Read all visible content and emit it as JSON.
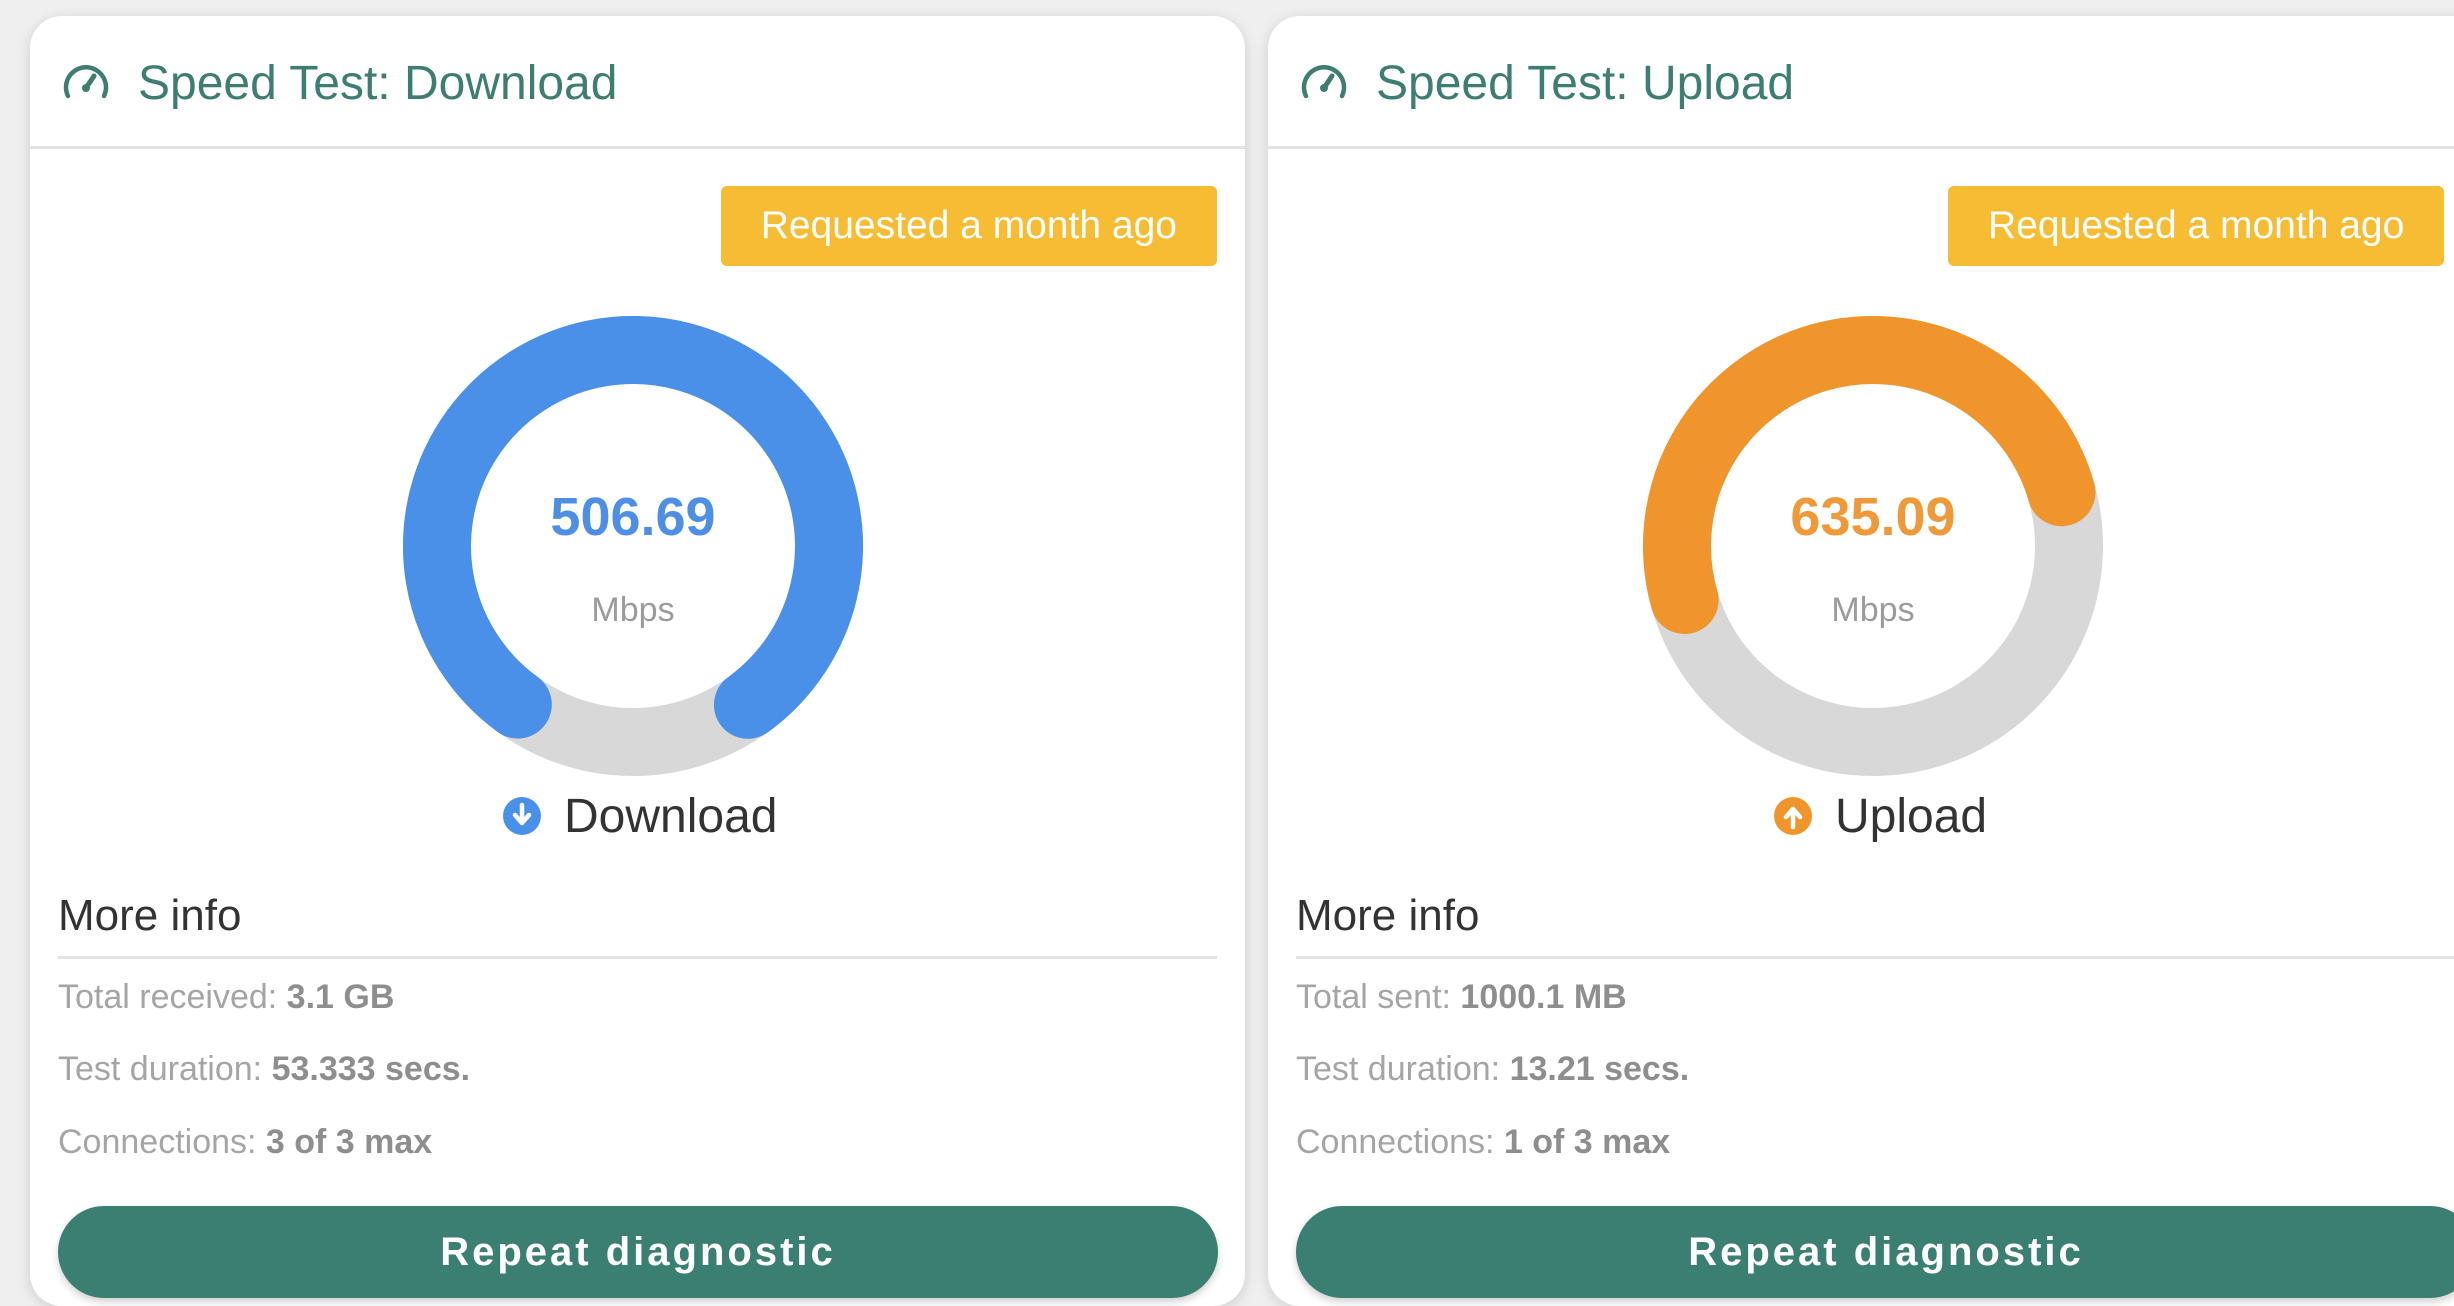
{
  "cards": [
    {
      "title": "Speed Test: Download",
      "badge": "Requested a month ago",
      "value": "506.69",
      "unit": "Mbps",
      "legend": "Download",
      "gauge_level": 0.8,
      "more_info": "More info",
      "rows": [
        {
          "label": "Total received: ",
          "value": "3.1 GB"
        },
        {
          "label": "Test duration: ",
          "value": "53.333 secs."
        },
        {
          "label": "Connections: ",
          "value": "3 of 3 max"
        }
      ],
      "button": "Repeat diagnostic"
    },
    {
      "title": "Speed Test: Upload",
      "badge": "Requested a month ago",
      "value": "635.09",
      "unit": "Mbps",
      "legend": "Upload",
      "gauge_level": 0.5,
      "more_info": "More info",
      "rows": [
        {
          "label": "Total sent: ",
          "value": "1000.1 MB"
        },
        {
          "label": "Test duration: ",
          "value": "13.21 secs."
        },
        {
          "label": "Connections: ",
          "value": "1 of 3 max"
        }
      ],
      "button": "Repeat diagnostic"
    }
  ],
  "colors": {
    "download": "#4a90e8",
    "upload": "#f0952c",
    "track": "#d8d8d8",
    "accent": "#3a7f71",
    "badge": "#f5bc34"
  },
  "icons": {
    "header": "speedometer-icon",
    "download": "download-circle-icon",
    "upload": "upload-circle-icon"
  }
}
